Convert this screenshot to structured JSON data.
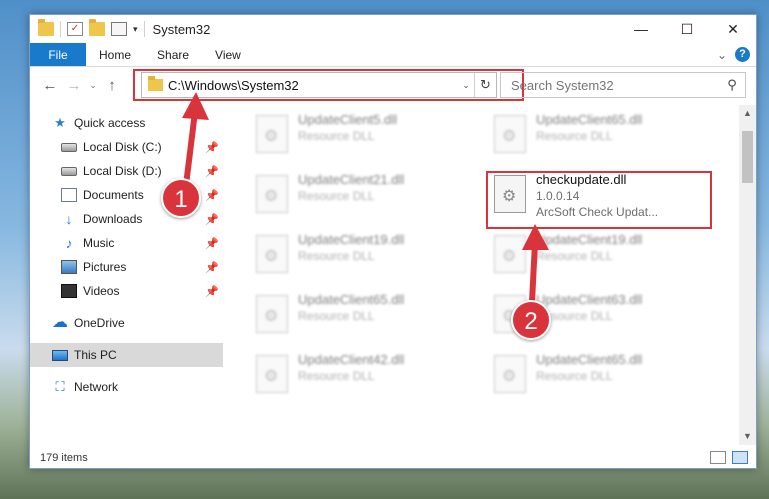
{
  "window": {
    "title": "System32",
    "minimize_glyph": "—",
    "maximize_glyph": "☐",
    "close_glyph": "✕"
  },
  "quick_access_toolbar": {
    "check_glyph": "✓",
    "dropdown_glyph": "▾"
  },
  "ribbon": {
    "tabs": [
      {
        "label": "File"
      },
      {
        "label": "Home"
      },
      {
        "label": "Share"
      },
      {
        "label": "View"
      }
    ],
    "expand_glyph": "⌄",
    "help_glyph": "?"
  },
  "navigation": {
    "back_glyph": "←",
    "forward_glyph": "→",
    "recent_glyph": "⌄",
    "up_glyph": "↑",
    "address": "C:\\Windows\\System32",
    "address_dropdown_glyph": "⌄",
    "refresh_glyph": "↻",
    "search_placeholder": "Search System32",
    "search_glyph": "⚲"
  },
  "sidebar": {
    "items": [
      {
        "label": "Quick access",
        "icon": "star-icon",
        "glyph": "★",
        "pinned": false
      },
      {
        "label": "Local Disk (C:)",
        "icon": "disk-icon",
        "pinned": true
      },
      {
        "label": "Local Disk (D:)",
        "icon": "disk-icon",
        "pinned": true
      },
      {
        "label": "Documents",
        "icon": "documents-icon",
        "pinned": true
      },
      {
        "label": "Downloads",
        "icon": "download-icon",
        "glyph": "↓",
        "pinned": true
      },
      {
        "label": "Music",
        "icon": "music-icon",
        "glyph": "♪",
        "pinned": true
      },
      {
        "label": "Pictures",
        "icon": "pictures-icon",
        "pinned": true
      },
      {
        "label": "Videos",
        "icon": "videos-icon",
        "pinned": true
      },
      {
        "label": "OneDrive",
        "icon": "cloud-icon",
        "glyph": "☁"
      },
      {
        "label": "This PC",
        "icon": "computer-icon",
        "selected": true
      },
      {
        "label": "Network",
        "icon": "network-icon",
        "glyph": "⛶"
      }
    ],
    "pin_glyph": "📌"
  },
  "files": [
    {
      "name": "UpdateClient5.dll",
      "desc": "Resource DLL",
      "blurred": true
    },
    {
      "name": "UpdateClient65.dll",
      "desc": "Resource DLL",
      "blurred": true
    },
    {
      "name": "UpdateClient21.dll",
      "desc": "Resource DLL",
      "blurred": true
    },
    {
      "name": "checkupdate.dll",
      "version": "1.0.0.14",
      "desc": "ArcSoft Check Updat...",
      "blurred": false,
      "highlighted": true
    },
    {
      "name": "UpdateClient19.dll",
      "desc": "Resource DLL",
      "blurred": true
    },
    {
      "name": "UpdateClient19.dll",
      "desc": "Resource DLL",
      "blurred": true
    },
    {
      "name": "UpdateClient65.dll",
      "desc": "Resource DLL",
      "blurred": true
    },
    {
      "name": "UpdateClient63.dll",
      "desc": "Resource DLL",
      "blurred": true
    },
    {
      "name": "UpdateClient42.dll",
      "desc": "Resource DLL",
      "blurred": true
    },
    {
      "name": "UpdateClient65.dll",
      "desc": "Resource DLL",
      "blurred": true
    }
  ],
  "scrollbar": {
    "up_glyph": "▲",
    "down_glyph": "▼"
  },
  "status": {
    "item_count": "179 items"
  },
  "callouts": [
    {
      "number": "1"
    },
    {
      "number": "2"
    }
  ],
  "colors": {
    "accent": "#1979ca",
    "callout_red": "#d9343b"
  }
}
